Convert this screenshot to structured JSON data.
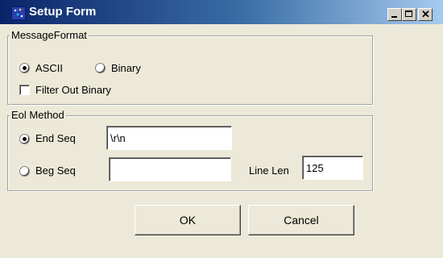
{
  "window": {
    "title": "Setup Form",
    "controls": {
      "minimize_icon": "minimize-icon",
      "maximize_icon": "maximize-icon",
      "close_icon": "close-icon"
    }
  },
  "message_format": {
    "legend": "MessageFormat",
    "ascii_label": "ASCII",
    "ascii_checked": true,
    "binary_label": "Binary",
    "binary_checked": false,
    "filter_label": "Filter Out Binary",
    "filter_checked": false
  },
  "eol_method": {
    "legend": "Eol Method",
    "end_seq_label": "End Seq",
    "end_seq_checked": true,
    "end_seq_value": "\\r\\n",
    "beg_seq_label": "Beg Seq",
    "beg_seq_checked": false,
    "beg_seq_value": "",
    "line_len_label": "Line Len",
    "line_len_value": "125"
  },
  "buttons": {
    "ok_label": "OK",
    "cancel_label": "Cancel"
  }
}
